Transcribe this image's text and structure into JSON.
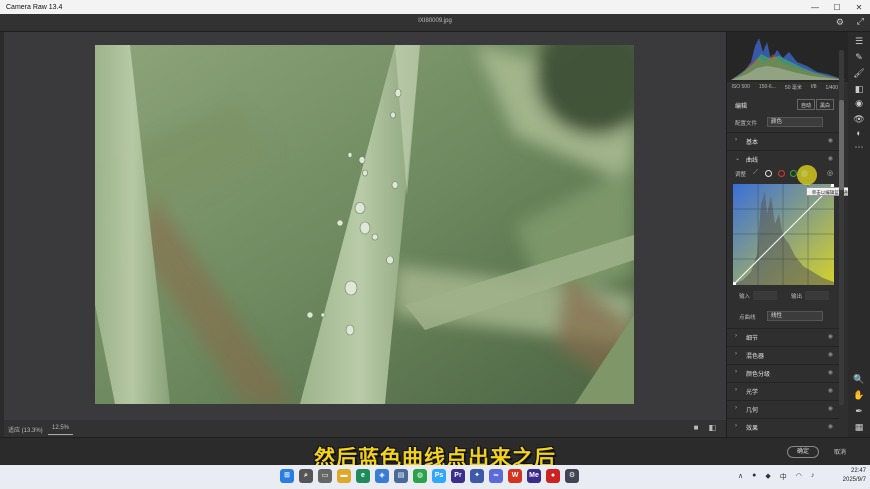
{
  "window": {
    "title": "Camera Raw 13.4",
    "min": "—",
    "max": "☐",
    "close": "✕"
  },
  "toolbar": {
    "filename": "IXI80009.jpg"
  },
  "camera_info": {
    "iso": "ISO 500",
    "lens": "150-6...",
    "focal": "50 毫米",
    "aperture": "f/8",
    "shutter": "1/400 秒"
  },
  "edit": {
    "label": "编辑",
    "auto": "自动",
    "bw": "黑白"
  },
  "profile": {
    "label": "配置文件",
    "value": "颜色"
  },
  "sections": [
    {
      "name": "基本",
      "expanded": false
    },
    {
      "name": "曲线",
      "expanded": true
    },
    {
      "name": "细节",
      "expanded": false
    },
    {
      "name": "混色器",
      "expanded": false
    },
    {
      "name": "颜色分级",
      "expanded": false
    },
    {
      "name": "光学",
      "expanded": false
    },
    {
      "name": "几何",
      "expanded": false
    },
    {
      "name": "效果",
      "expanded": false
    }
  ],
  "curve": {
    "adjust_label": "调整",
    "tooltip": "单击以编辑蓝色通道",
    "input_label": "输入",
    "output_label": "输出",
    "point_curve_label": "点曲线",
    "point_curve_value": "线性"
  },
  "bottom": {
    "fit": "适应 (13.3%)",
    "zoom": "12.5%"
  },
  "footer": {
    "ok": "确定",
    "cancel": "取消"
  },
  "subtitle": "然后蓝色曲线点出来之后",
  "taskbar": {
    "lang": "中",
    "time": "22:47",
    "date": "2025/9/7"
  },
  "colors": {
    "accent": "#f2d21f",
    "panel": "#2f2f2f",
    "blue_channel": "#3a6fd8"
  }
}
